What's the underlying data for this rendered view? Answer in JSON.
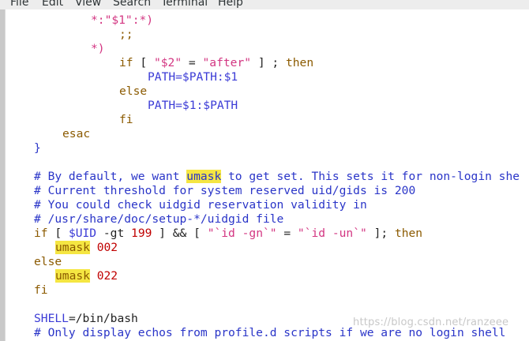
{
  "menu": {
    "items": [
      "File",
      "Edit",
      "View",
      "Search",
      "Terminal",
      "Help"
    ]
  },
  "watermark": "https://blog.csdn.net/ranzeee",
  "code": {
    "line1": "*:\"$1\":*)",
    "line2": ";;",
    "line3": "*)",
    "line4_if": "if",
    "line4_bracket": "[",
    "line4_var": "\"$2\"",
    "line4_eq": "=",
    "line4_str": "\"after\"",
    "line4_close": "] ;",
    "line4_then": "then",
    "line5": "PATH=$PATH:$1",
    "line6": "else",
    "line7": "PATH=$1:$PATH",
    "line8": "fi",
    "line9": "esac",
    "line10": "}",
    "line11_a": "# By default, we want ",
    "line11_hl": "umask",
    "line11_b": " to get set. This sets it for non-login she",
    "line12": "# Current threshold for system reserved uid/gids is 200",
    "line13": "# You could check uidgid reservation validity in",
    "line14": "# /usr/share/doc/setup-*/uidgid file",
    "line15_if": "if",
    "line15_a": " [ ",
    "line15_var": "$UID",
    "line15_b": " -gt ",
    "line15_num": "199",
    "line15_c": " ] && [ ",
    "line15_str1": "\"`id -gn`\"",
    "line15_eq": " = ",
    "line15_str2": "\"`id -un`\"",
    "line15_d": " ];",
    "line15_then": "then",
    "line16_hl": "umask",
    "line16_num": "002",
    "line17": "else",
    "line18_hl": "umask",
    "line18_num": "022",
    "line19": "fi",
    "line20_var": "SHELL",
    "line20_rest": "=/bin/bash",
    "line21": "# Only display echos from profile.d scripts if we are no login shell"
  }
}
